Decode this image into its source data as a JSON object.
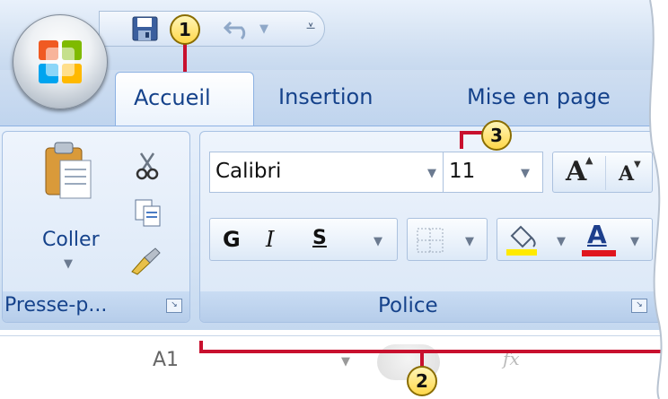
{
  "tabs": [
    {
      "label": "Accueil",
      "active": true
    },
    {
      "label": "Insertion",
      "active": false
    },
    {
      "label": "Mise en page",
      "active": false
    }
  ],
  "clipboard_group": {
    "paste_label": "Coller",
    "footer_label": "Presse-p..."
  },
  "font_group": {
    "font_name": "Calibri",
    "font_size": "11",
    "bold_label": "G",
    "italic_label": "I",
    "underline_label": "S",
    "grow_font_label": "A",
    "shrink_font_label": "A",
    "font_color_label": "A",
    "footer_label": "Police",
    "highlight_color": "#ffea00",
    "font_color": "#e0161d"
  },
  "formula_bar": {
    "name_box": "A1",
    "fx_label": "fx"
  },
  "callouts": [
    "1",
    "2",
    "3"
  ],
  "colors": {
    "accent": "#15428b",
    "callout_line": "#c8102e"
  }
}
